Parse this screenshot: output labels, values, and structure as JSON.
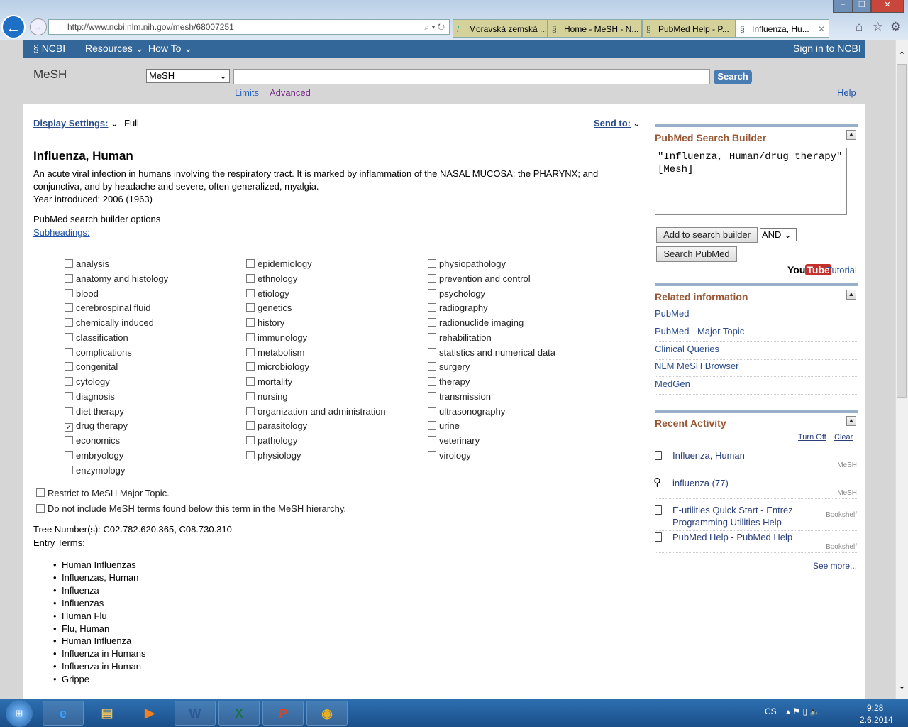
{
  "browser": {
    "url": "http://www.ncbi.nlm.nih.gov/mesh/68007251",
    "tabs": [
      {
        "label": "Moravská zemská ..."
      },
      {
        "label": "Home - MeSH - N..."
      },
      {
        "label": "PubMed Help - P..."
      },
      {
        "label": "Influenza, Hu..."
      }
    ]
  },
  "ncbi": {
    "logo": "NCBI",
    "resources": "Resources",
    "howto": "How To",
    "signin": "Sign in to NCBI"
  },
  "search": {
    "db_label": "MeSH",
    "db_selected": "MeSH",
    "query": "",
    "button": "Search",
    "limits": "Limits",
    "advanced": "Advanced",
    "help": "Help"
  },
  "display": {
    "label": "Display Settings:",
    "value": "Full",
    "sendto": "Send to:"
  },
  "term": {
    "title": "Influenza, Human",
    "desc": "An acute viral infection in humans involving the respiratory tract. It is marked by inflammation of the NASAL MUCOSA; the PHARYNX; and conjunctiva, and by headache and severe, often generalized, myalgia.",
    "year": "Year introduced: 2006 (1963)",
    "builder_options": "PubMed search builder options",
    "subheadings": "Subheadings:"
  },
  "subheadings": [
    [
      "analysis",
      "anatomy and histology",
      "blood",
      "cerebrospinal fluid",
      "chemically induced",
      "classification",
      "complications",
      "congenital",
      "cytology",
      "diagnosis",
      "diet therapy",
      "drug therapy",
      "economics",
      "embryology",
      "enzymology"
    ],
    [
      "epidemiology",
      "ethnology",
      "etiology",
      "genetics",
      "history",
      "immunology",
      "metabolism",
      "microbiology",
      "mortality",
      "nursing",
      "organization and administration",
      "parasitology",
      "pathology",
      "physiology"
    ],
    [
      "physiopathology",
      "prevention and control",
      "psychology",
      "radiography",
      "radionuclide imaging",
      "rehabilitation",
      "statistics and numerical data",
      "surgery",
      "therapy",
      "transmission",
      "ultrasonography",
      "urine",
      "veterinary",
      "virology"
    ]
  ],
  "checked": [
    "drug therapy"
  ],
  "options": {
    "major": "Restrict to MeSH Major Topic.",
    "noexplode": "Do not include MeSH terms found below this term in the MeSH hierarchy."
  },
  "tree": "Tree Number(s): C02.782.620.365, C08.730.310",
  "entry_label": "Entry Terms:",
  "entry_terms": [
    "Human Influenzas",
    "Influenzas, Human",
    "Influenza",
    "Influenzas",
    "Human Flu",
    "Flu, Human",
    "Human Influenza",
    "Influenza in Humans",
    "Influenza in Human",
    "Grippe"
  ],
  "builder": {
    "title": "PubMed Search Builder",
    "text": "\"Influenza, Human/drug therapy\"[Mesh]",
    "add": "Add to search builder",
    "op": "AND",
    "searchpubmed": "Search PubMed",
    "youtube": "YouTube",
    "tutorial": "Tutorial"
  },
  "related": {
    "title": "Related information",
    "links": [
      "PubMed",
      "PubMed - Major Topic",
      "Clinical Queries",
      "NLM MeSH Browser",
      "MedGen"
    ]
  },
  "recent": {
    "title": "Recent Activity",
    "turnoff": "Turn Off",
    "clear": "Clear",
    "items": [
      {
        "icon": "document-icon",
        "label": "Influenza, Human",
        "src": "MeSH"
      },
      {
        "icon": "search-icon",
        "label": "influenza (77)",
        "src": "MeSH"
      },
      {
        "icon": "document-icon",
        "label": "E-utilities Quick Start - Entrez Programming Utilities Help",
        "src": "Bookshelf"
      },
      {
        "icon": "document-icon",
        "label": "PubMed Help - PubMed Help",
        "src": "Bookshelf"
      }
    ],
    "seemore": "See more..."
  },
  "tray": {
    "lang": "CS",
    "time": "9:28",
    "date": "2.6.2014"
  }
}
